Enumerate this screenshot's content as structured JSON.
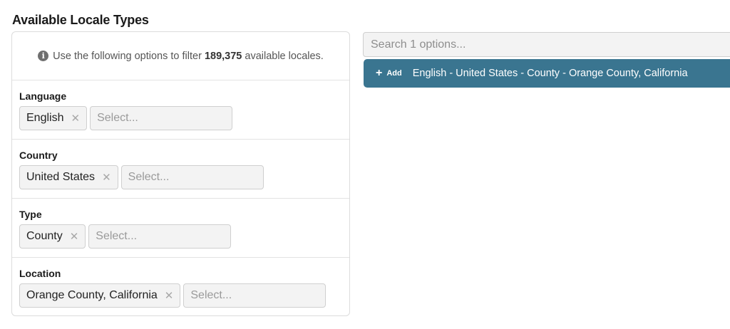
{
  "page": {
    "title": "Available Locale Types"
  },
  "info": {
    "prefix": "Use the following options to filter ",
    "count": "189,375",
    "suffix": " available locales."
  },
  "filters": [
    {
      "label": "Language",
      "selected": "English",
      "placeholder": "Select..."
    },
    {
      "label": "Country",
      "selected": "United States",
      "placeholder": "Select..."
    },
    {
      "label": "Type",
      "selected": "County",
      "placeholder": "Select..."
    },
    {
      "label": "Location",
      "selected": "Orange County, California",
      "placeholder": "Select..."
    }
  ],
  "search": {
    "placeholder": "Search 1 options..."
  },
  "results": [
    {
      "add_label": "Add",
      "text": "English - United States - County - Orange County, California"
    }
  ],
  "colors": {
    "result_bar": "#3a7590",
    "tag_bg": "#f3f3f3"
  },
  "icons": {
    "info": "info-circle-icon",
    "remove": "close-icon",
    "add": "plus-icon"
  }
}
